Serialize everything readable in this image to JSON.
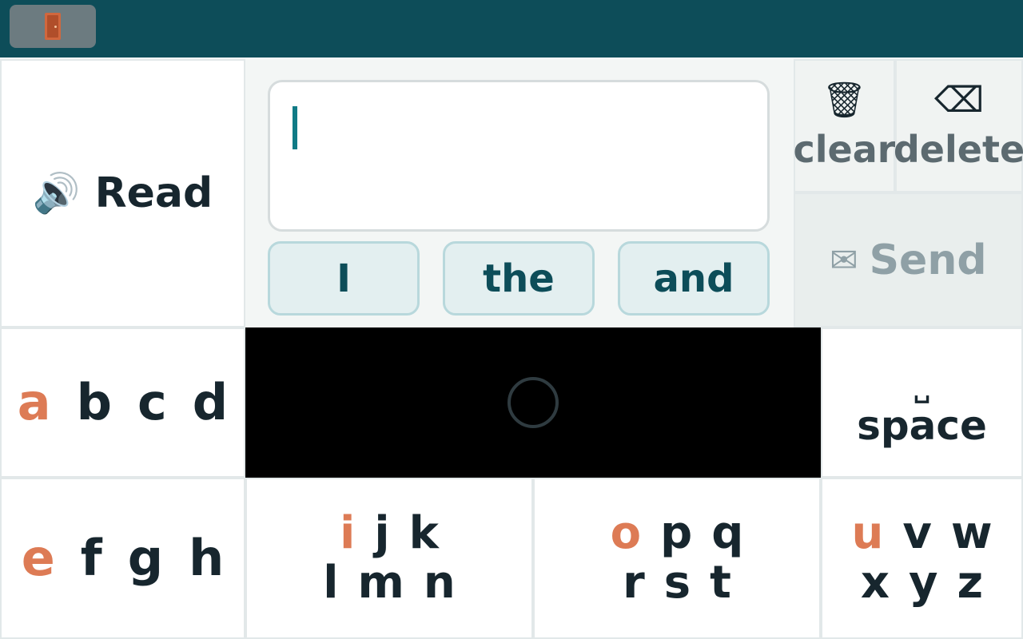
{
  "topbar": {
    "exit_icon": "door-icon",
    "background": "#0d4d59"
  },
  "read": {
    "icon": "speaker-icon",
    "icon_glyph": "🔊",
    "label": "Read"
  },
  "editor": {
    "text": "",
    "caret_color": "#107b86"
  },
  "suggestions": [
    "I",
    "the",
    "and"
  ],
  "actions": {
    "clear": {
      "icon": "trash-icon",
      "icon_glyph": "🗑",
      "label": "clear"
    },
    "delete": {
      "icon": "backspace-icon",
      "icon_glyph": "⌫",
      "label": "delete"
    },
    "send": {
      "icon": "envelope-icon",
      "icon_glyph": "✉",
      "label": "Send"
    }
  },
  "space": {
    "symbol": "␣",
    "label": "space"
  },
  "keys": {
    "abcd": {
      "vowel": "a",
      "rows": [
        [
          "b",
          "c",
          "d"
        ]
      ]
    },
    "efgh": {
      "vowel": "e",
      "rows": [
        [
          "f",
          "g",
          "h"
        ]
      ]
    },
    "ijk": {
      "vowel": "i",
      "rows": [
        [
          "j",
          "k"
        ],
        [
          "l",
          "m",
          "n"
        ]
      ]
    },
    "opq": {
      "vowel": "o",
      "rows": [
        [
          "p",
          "q"
        ],
        [
          "r",
          "s",
          "t"
        ]
      ]
    },
    "uvw": {
      "vowel": "u",
      "rows": [
        [
          "v",
          "w"
        ],
        [
          "x",
          "y",
          "z"
        ]
      ]
    }
  },
  "colors": {
    "vowel": "#dd7b55",
    "text": "#17262e",
    "accent": "#0d4d59"
  }
}
